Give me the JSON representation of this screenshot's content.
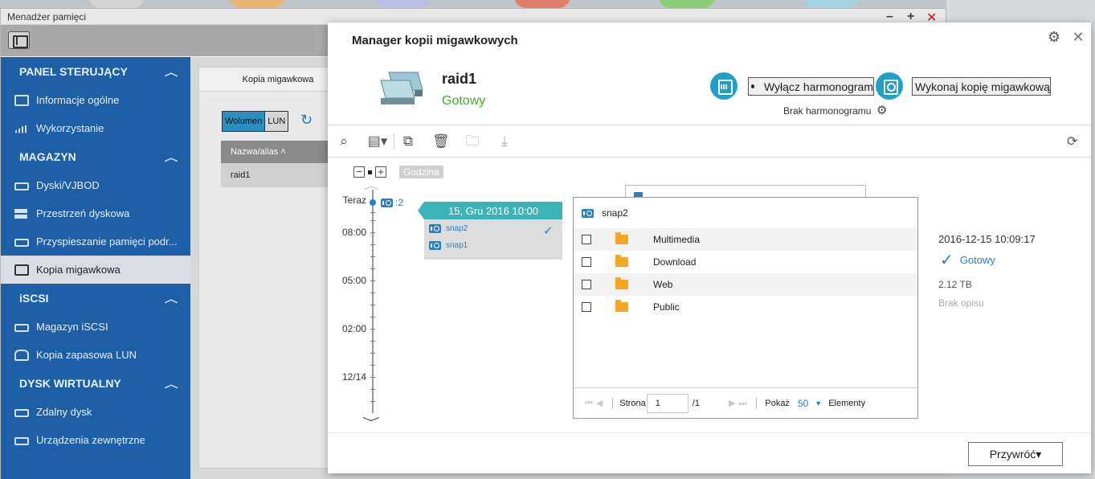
{
  "storage_window": {
    "title": "Menadżer pamięci",
    "sidebar": [
      {
        "heading": "PANEL STERUJĄCY",
        "items": [
          {
            "label": "Informacje ogólne",
            "icon": "overview-icon"
          },
          {
            "label": "Wykorzystanie",
            "icon": "usage-chart-icon"
          }
        ]
      },
      {
        "heading": "MAGAZYN",
        "items": [
          {
            "label": "Dyski/VJBOD",
            "icon": "disk-icon"
          },
          {
            "label": "Przestrzeń dyskowa",
            "icon": "storage-space-icon"
          },
          {
            "label": "Przyspieszanie pamięci podr...",
            "icon": "cache-icon"
          },
          {
            "label": "Kopia migawkowa",
            "icon": "snapshot-icon",
            "active": true
          }
        ]
      },
      {
        "heading": "iSCSI",
        "items": [
          {
            "label": "Magazyn iSCSI",
            "icon": "iscsi-storage-icon"
          },
          {
            "label": "Kopia zapasowa LUN",
            "icon": "lun-backup-icon"
          }
        ]
      },
      {
        "heading": "DYSK WIRTUALNY",
        "items": [
          {
            "label": "Zdalny dysk",
            "icon": "remote-disk-icon"
          },
          {
            "label": "Urządzenia zewnętrzne",
            "icon": "external-devices-icon"
          }
        ]
      }
    ],
    "panel": {
      "tab": "Kopia migawkowa",
      "seg_volume": "Wolumen",
      "seg_lun": "LUN",
      "table_header": "Nazwa/alias ˄",
      "rows": [
        "raid1"
      ]
    }
  },
  "dialog": {
    "title": "Manager kopii migawkowych",
    "volume_name": "raid1",
    "volume_status": "Gotowy",
    "schedule_button": "Wyłącz harmonogram",
    "snapshot_button": "Wykonaj kopię migawkową",
    "no_schedule": "Brak harmonogramu",
    "zoom_label": "Godzina",
    "timeline": {
      "now_label": "Teraz",
      "snap_count": ":2",
      "labels": [
        "08:00",
        "05:00",
        "02:00",
        "12/14"
      ]
    },
    "date_tag": "15, Gru 2016 10:00",
    "snapshots": [
      "snap2",
      "snap1"
    ],
    "browser": {
      "title": "snap2",
      "folders": [
        "Multimedia",
        "Download",
        "Web",
        "Public"
      ],
      "page_label": "Strona",
      "page_value": "1",
      "page_total": "/1",
      "show_label": "Pokaż",
      "page_size": "50",
      "items_label": "Elementy"
    },
    "info": {
      "timestamp": "2016-12-15 10:09:17",
      "status": "Gotowy",
      "size": "2.12 TB",
      "description": "Brak opisu"
    },
    "restore_button": "Przywróć▾"
  },
  "colors": {
    "sidebar": "#1e5fa8",
    "accent": "#21a0c6",
    "ok_green": "#3fae29",
    "link_blue": "#2b7fc2"
  }
}
